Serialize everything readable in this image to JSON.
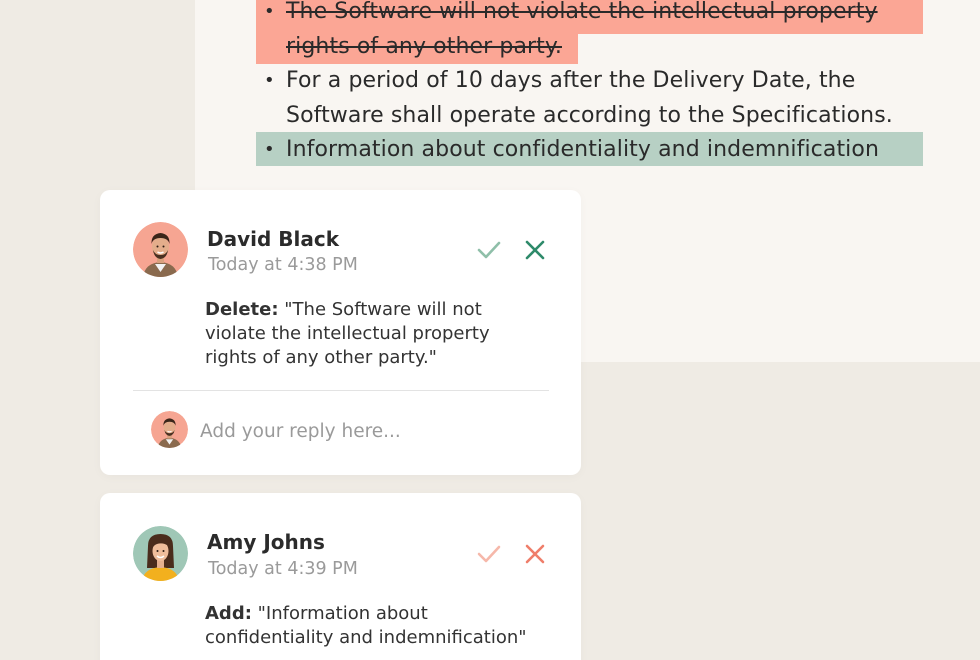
{
  "document": {
    "items": [
      {
        "state": "deleted",
        "lines": [
          "The Software will not violate the intellectual property",
          "rights of any other party."
        ]
      },
      {
        "state": "normal",
        "lines": [
          "For a period of 10 days after the Delivery Date, the",
          "Software shall operate according to the Specifications."
        ]
      },
      {
        "state": "added",
        "lines": [
          "Information about confidentiality and indemnification"
        ]
      }
    ],
    "bullet": "•"
  },
  "comments": [
    {
      "author": "David Black",
      "time": "Today at 4:38 PM",
      "action_label": "Delete:",
      "quote": "\"The Software will not violate the intellectual property rights of any other party.\"",
      "accept_icon": "checkmark-icon",
      "reject_icon": "close-icon",
      "accept_color": "#8fbfa9",
      "reject_color": "#2e8a6a",
      "avatar_bg": "#f6a592",
      "reply_placeholder": "Add your reply here..."
    },
    {
      "author": "Amy Johns",
      "time": "Today at 4:39 PM",
      "action_label": "Add:",
      "quote": "\"Information about confidentiality and indemnification\"",
      "accept_icon": "checkmark-icon",
      "reject_icon": "close-icon",
      "accept_color": "#f6b8aa",
      "reject_color": "#ef7e6a",
      "avatar_bg": "#9fc7b6"
    }
  ],
  "colors": {
    "deleted_highlight": "#fba695",
    "added_highlight": "#b7d0c4",
    "background": "#efebe4",
    "document_bg": "#f9f6f2"
  }
}
